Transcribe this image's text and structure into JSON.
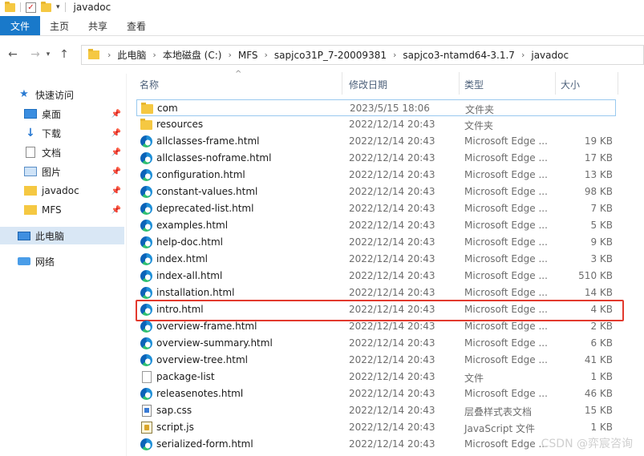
{
  "window": {
    "title": "javadoc"
  },
  "ribbon": {
    "tabs": [
      {
        "label": "文件",
        "active": true
      },
      {
        "label": "主页"
      },
      {
        "label": "共享"
      },
      {
        "label": "查看"
      }
    ]
  },
  "nav": {
    "back_icon": "arrow-left-icon",
    "forward_icon": "arrow-right-icon",
    "recent_icon": "chevron-down-icon",
    "up_icon": "arrow-up-icon"
  },
  "address": {
    "crumbs": [
      "此电脑",
      "本地磁盘 (C:)",
      "MFS",
      "sapjco31P_7-20009381",
      "sapjco3-ntamd64-3.1.7",
      "javadoc"
    ]
  },
  "sidebar": {
    "items": [
      {
        "label": "快速访问",
        "icon": "star-icon",
        "pinned": false
      },
      {
        "label": "桌面",
        "icon": "desktop-icon",
        "pinned": true
      },
      {
        "label": "下载",
        "icon": "download-icon",
        "pinned": true
      },
      {
        "label": "文档",
        "icon": "document-icon",
        "pinned": true
      },
      {
        "label": "图片",
        "icon": "picture-icon",
        "pinned": true
      },
      {
        "label": "javadoc",
        "icon": "folder-icon",
        "pinned": true
      },
      {
        "label": "MFS",
        "icon": "folder-icon",
        "pinned": true
      },
      {
        "label": "此电脑",
        "icon": "computer-icon",
        "selected": true
      },
      {
        "label": "网络",
        "icon": "network-icon"
      }
    ]
  },
  "columns": {
    "name": "名称",
    "date": "修改日期",
    "type": "类型",
    "size": "大小"
  },
  "files": [
    {
      "name": "com",
      "date": "2023/5/15 18:06",
      "type": "文件夹",
      "size": "",
      "icon": "folder"
    },
    {
      "name": "resources",
      "date": "2022/12/14 20:43",
      "type": "文件夹",
      "size": "",
      "icon": "folder"
    },
    {
      "name": "allclasses-frame.html",
      "date": "2022/12/14 20:43",
      "type": "Microsoft Edge ...",
      "size": "19 KB",
      "icon": "edge"
    },
    {
      "name": "allclasses-noframe.html",
      "date": "2022/12/14 20:43",
      "type": "Microsoft Edge ...",
      "size": "17 KB",
      "icon": "edge"
    },
    {
      "name": "configuration.html",
      "date": "2022/12/14 20:43",
      "type": "Microsoft Edge ...",
      "size": "13 KB",
      "icon": "edge"
    },
    {
      "name": "constant-values.html",
      "date": "2022/12/14 20:43",
      "type": "Microsoft Edge ...",
      "size": "98 KB",
      "icon": "edge"
    },
    {
      "name": "deprecated-list.html",
      "date": "2022/12/14 20:43",
      "type": "Microsoft Edge ...",
      "size": "7 KB",
      "icon": "edge"
    },
    {
      "name": "examples.html",
      "date": "2022/12/14 20:43",
      "type": "Microsoft Edge ...",
      "size": "5 KB",
      "icon": "edge"
    },
    {
      "name": "help-doc.html",
      "date": "2022/12/14 20:43",
      "type": "Microsoft Edge ...",
      "size": "9 KB",
      "icon": "edge"
    },
    {
      "name": "index.html",
      "date": "2022/12/14 20:43",
      "type": "Microsoft Edge ...",
      "size": "3 KB",
      "icon": "edge"
    },
    {
      "name": "index-all.html",
      "date": "2022/12/14 20:43",
      "type": "Microsoft Edge ...",
      "size": "510 KB",
      "icon": "edge"
    },
    {
      "name": "installation.html",
      "date": "2022/12/14 20:43",
      "type": "Microsoft Edge ...",
      "size": "14 KB",
      "icon": "edge"
    },
    {
      "name": "intro.html",
      "date": "2022/12/14 20:43",
      "type": "Microsoft Edge ...",
      "size": "4 KB",
      "icon": "edge",
      "highlighted": true
    },
    {
      "name": "overview-frame.html",
      "date": "2022/12/14 20:43",
      "type": "Microsoft Edge ...",
      "size": "2 KB",
      "icon": "edge"
    },
    {
      "name": "overview-summary.html",
      "date": "2022/12/14 20:43",
      "type": "Microsoft Edge ...",
      "size": "6 KB",
      "icon": "edge"
    },
    {
      "name": "overview-tree.html",
      "date": "2022/12/14 20:43",
      "type": "Microsoft Edge ...",
      "size": "41 KB",
      "icon": "edge"
    },
    {
      "name": "package-list",
      "date": "2022/12/14 20:43",
      "type": "文件",
      "size": "1 KB",
      "icon": "file"
    },
    {
      "name": "releasenotes.html",
      "date": "2022/12/14 20:43",
      "type": "Microsoft Edge ...",
      "size": "46 KB",
      "icon": "edge"
    },
    {
      "name": "sap.css",
      "date": "2022/12/14 20:43",
      "type": "层叠样式表文档",
      "size": "15 KB",
      "icon": "css"
    },
    {
      "name": "script.js",
      "date": "2022/12/14 20:43",
      "type": "JavaScript 文件",
      "size": "1 KB",
      "icon": "js"
    },
    {
      "name": "serialized-form.html",
      "date": "2022/12/14 20:43",
      "type": "Microsoft Edge ...",
      "size": "",
      "icon": "edge"
    }
  ],
  "watermark": "CSDN @弈宸咨询",
  "colors": {
    "accent": "#1979ca",
    "highlight_border": "#e23a2e",
    "selection": "#d9e7f5"
  }
}
